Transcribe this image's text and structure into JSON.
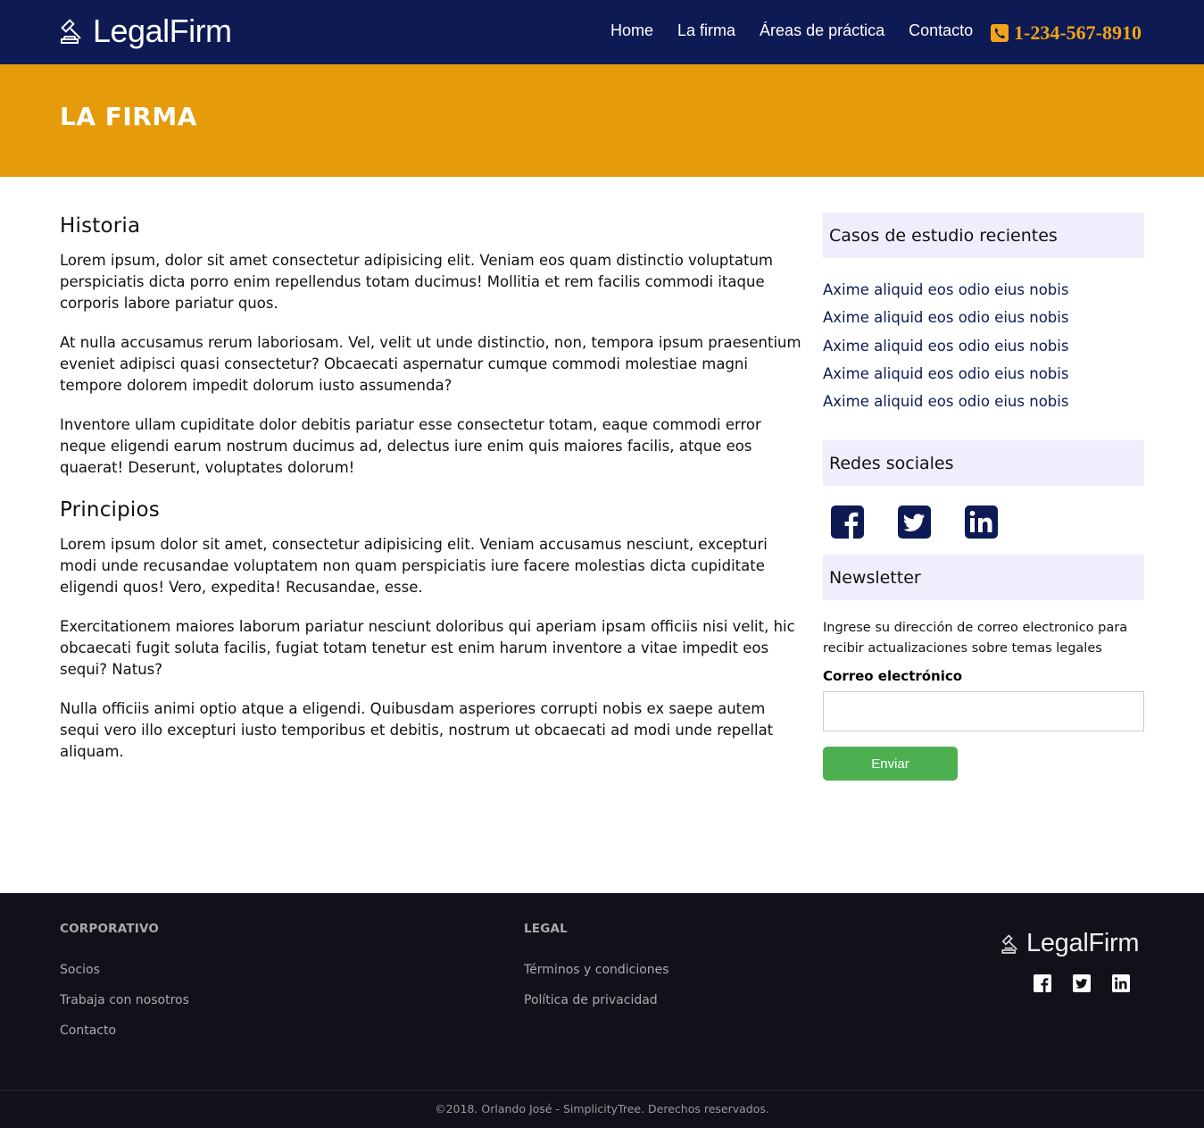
{
  "header": {
    "brand": "LegalFirm",
    "nav": [
      "Home",
      "La firma",
      "Áreas de práctica",
      "Contacto"
    ],
    "phone": "1-234-567-8910"
  },
  "hero": {
    "title": "LA FIRMA"
  },
  "main": {
    "section1_title": "Historia",
    "section1_paragraphs": [
      "Lorem ipsum, dolor sit amet consectetur adipisicing elit. Veniam eos quam distinctio voluptatum perspiciatis dicta porro enim repellendus totam ducimus! Mollitia et rem facilis commodi itaque corporis labore pariatur quos.",
      "At nulla accusamus rerum laboriosam. Vel, velit ut unde distinctio, non, tempora ipsum praesentium eveniet adipisci quasi consectetur? Obcaecati aspernatur cumque commodi molestiae magni tempore dolorem impedit dolorum iusto assumenda?",
      "Inventore ullam cupiditate dolor debitis pariatur esse consectetur totam, eaque commodi error neque eligendi earum nostrum ducimus ad, delectus iure enim quis maiores facilis, atque eos quaerat! Deserunt, voluptates dolorum!"
    ],
    "section2_title": "Principios",
    "section2_paragraphs": [
      "Lorem ipsum dolor sit amet, consectetur adipisicing elit. Veniam accusamus nesciunt, excepturi modi unde recusandae voluptatem non quam perspiciatis iure facere molestias dicta cupiditate eligendi quos! Vero, expedita! Recusandae, esse.",
      "Exercitationem maiores laborum pariatur nesciunt doloribus qui aperiam ipsam officiis nisi velit, hic obcaecati fugit soluta facilis, fugiat totam tenetur est enim harum inventore a vitae impedit eos sequi? Natus?",
      "Nulla officiis animi optio atque a eligendi. Quibusdam asperiores corrupti nobis ex saepe autem sequi vero illo excepturi iusto temporibus et debitis, nostrum ut obcaecati ad modi unde repellat aliquam."
    ]
  },
  "sidebar": {
    "cases_title": "Casos de estudio recientes",
    "cases": [
      "Axime aliquid eos odio eius nobis",
      "Axime aliquid eos odio eius nobis",
      "Axime aliquid eos odio eius nobis",
      "Axime aliquid eos odio eius nobis",
      "Axime aliquid eos odio eius nobis"
    ],
    "social_title": "Redes sociales",
    "social_icons": [
      "facebook-icon",
      "twitter-icon",
      "linkedin-icon"
    ],
    "newsletter_title": "Newsletter",
    "newsletter_text": "Ingrese su dirección de correo electronico para recibir actualizaciones sobre temas legales",
    "email_label": "Correo electrónico",
    "email_value": "",
    "submit_label": "Enviar"
  },
  "footer": {
    "col1_title": "CORPORATIVO",
    "col1_links": [
      "Socios",
      "Trabaja con nosotros",
      "Contacto"
    ],
    "col2_title": "LEGAL",
    "col2_links": [
      "Términos y condiciones",
      "Política de privacidad"
    ],
    "brand": "LegalFirm",
    "copyright": "©2018. Orlando José - SimplicityTree. Derechos reservados."
  },
  "colors": {
    "header_bg": "#0d1a54",
    "hero_bg": "#e69b0a",
    "phone": "#f0a419",
    "sidebar_head_bg": "#efeefc",
    "button_bg": "#4cb050",
    "footer_bg": "#111119"
  }
}
